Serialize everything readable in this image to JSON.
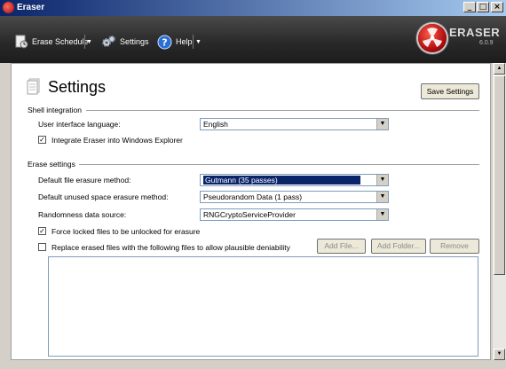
{
  "window": {
    "title": "Eraser"
  },
  "toolbar": {
    "erase_schedule": "Erase Schedule",
    "settings": "Settings",
    "help": "Help"
  },
  "logo": {
    "name": "ERASER",
    "version": "6.0.9"
  },
  "page": {
    "title": "Settings",
    "save_button": "Save Settings"
  },
  "shell": {
    "section": "Shell integration",
    "language_label": "User interface language:",
    "language_value": "English",
    "integrate_label": "Integrate Eraser into Windows Explorer",
    "integrate_checked": true
  },
  "erase": {
    "section": "Erase settings",
    "file_method_label": "Default file erasure method:",
    "file_method_value": "Gutmann (35 passes)",
    "unused_method_label": "Default unused space erasure method:",
    "unused_method_value": "Pseudorandom Data (1 pass)",
    "randomness_label": "Randomness data source:",
    "randomness_value": "RNGCryptoServiceProvider",
    "force_unlock_label": "Force locked files to be unlocked for erasure",
    "force_unlock_checked": true,
    "replace_label": "Replace erased files with the following files to allow plausible deniability",
    "replace_checked": false,
    "add_file": "Add File...",
    "add_folder": "Add Folder...",
    "remove": "Remove"
  },
  "colors": {
    "header_dark": "#2a2a2a",
    "selection": "#0a246a",
    "accent_red": "#b30f0f"
  }
}
